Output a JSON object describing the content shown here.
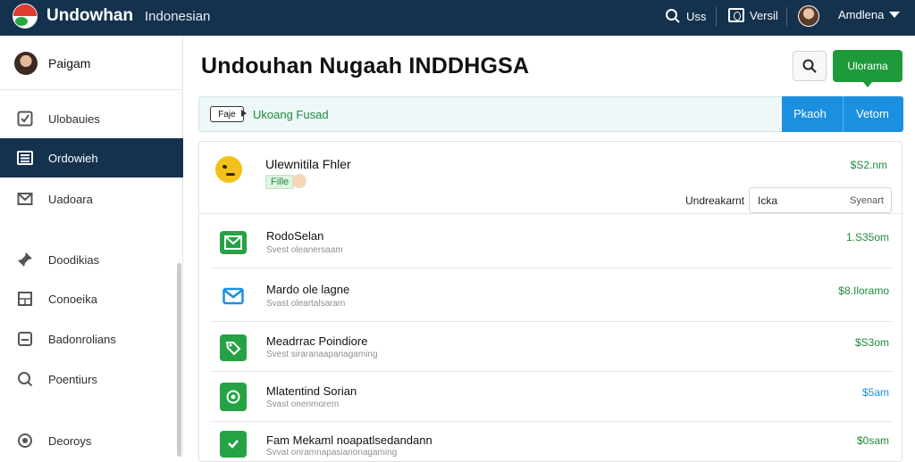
{
  "topbar": {
    "brand": "Undowhan",
    "language": "Indonesian",
    "search_label": "Uss",
    "version_label": "Versil",
    "user_name": "Amdlena"
  },
  "sidebar": {
    "profile_name": "Paigam",
    "items": [
      {
        "label": "Ulobauies",
        "icon": "checkbox-icon"
      },
      {
        "label": "Ordowieh",
        "icon": "list-icon",
        "active": true
      },
      {
        "label": "Uadoara",
        "icon": "mail-icon"
      },
      {
        "label": "Doodikias",
        "icon": "pin-icon"
      },
      {
        "label": "Conoeika",
        "icon": "grid-icon"
      },
      {
        "label": "Badonrolians",
        "icon": "square-icon"
      },
      {
        "label": "Poentiurs",
        "icon": "search-icon"
      },
      {
        "label": "Deoroys",
        "icon": "target-icon"
      }
    ]
  },
  "main": {
    "title": "Undouhan Nugaah INDDHGSA",
    "primary_button": "Ulorama",
    "filter": {
      "tag": "Faje",
      "text": "Ukoang Fusad",
      "btn_left": "Pkaoh",
      "btn_right": "Vetom"
    },
    "card": {
      "title": "Ulewnitila Fhler",
      "chip": "Fille",
      "amount": "$S2.nm",
      "sort_label": "Undreakarnt",
      "sort_value": "Icka",
      "sort_suffix": "Syenart"
    },
    "rows": [
      {
        "title": "RodoSelan",
        "sub": "Svest oleanersaam",
        "amount": "1.S35om",
        "amount_color": "#1e8a3a",
        "icon_bg": "#25a244",
        "icon": "mail-icon"
      },
      {
        "title": "Mardo ole lagne",
        "sub": "Svast oleartalsaram",
        "amount": "$8.Iloramo",
        "amount_color": "#1e8a3a",
        "icon_bg": "#ffffff",
        "icon": "envelope-icon"
      },
      {
        "title": "Meadrrac Poindiore",
        "sub": "Svest siraranaapanagaming",
        "amount": "$S3om",
        "amount_color": "#1e8a3a",
        "icon_bg": "#25a244",
        "icon": "tag-icon"
      },
      {
        "title": "Mlatentind Sorian",
        "sub": "Svast onenmorem",
        "amount": "$5am",
        "amount_color": "#1b8fe0",
        "icon_bg": "#25a244",
        "icon": "location-icon"
      },
      {
        "title": "Fam Mekaml noapatlsedandann",
        "sub": "Svvat onramnapasianonagaming",
        "amount": "$0sam",
        "amount_color": "#1e8a3a",
        "icon_bg": "#25a244",
        "icon": "shield-check-icon"
      }
    ]
  }
}
